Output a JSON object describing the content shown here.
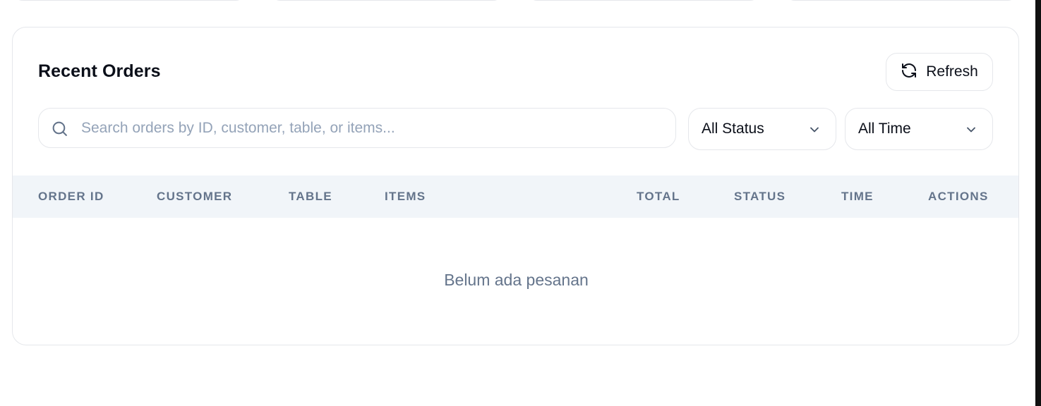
{
  "recent_orders": {
    "title": "Recent Orders",
    "refresh_label": "Refresh",
    "search": {
      "placeholder": "Search orders by ID, customer, table, or items...",
      "value": ""
    },
    "filters": {
      "status": {
        "selected": "All Status"
      },
      "time": {
        "selected": "All Time"
      }
    },
    "table": {
      "columns": [
        "ORDER ID",
        "CUSTOMER",
        "TABLE",
        "ITEMS",
        "TOTAL",
        "STATUS",
        "TIME",
        "ACTIONS"
      ],
      "rows": [],
      "empty_message": "Belum ada pesanan"
    }
  },
  "icons": {
    "search": "search-icon",
    "refresh": "refresh-icon",
    "chevron": "chevron-down-icon"
  },
  "colors": {
    "text_primary": "#0b0f19",
    "text_muted": "#64748b",
    "placeholder": "#94a3b8",
    "border": "#e5e7eb",
    "header_bg": "#f1f5f9"
  }
}
